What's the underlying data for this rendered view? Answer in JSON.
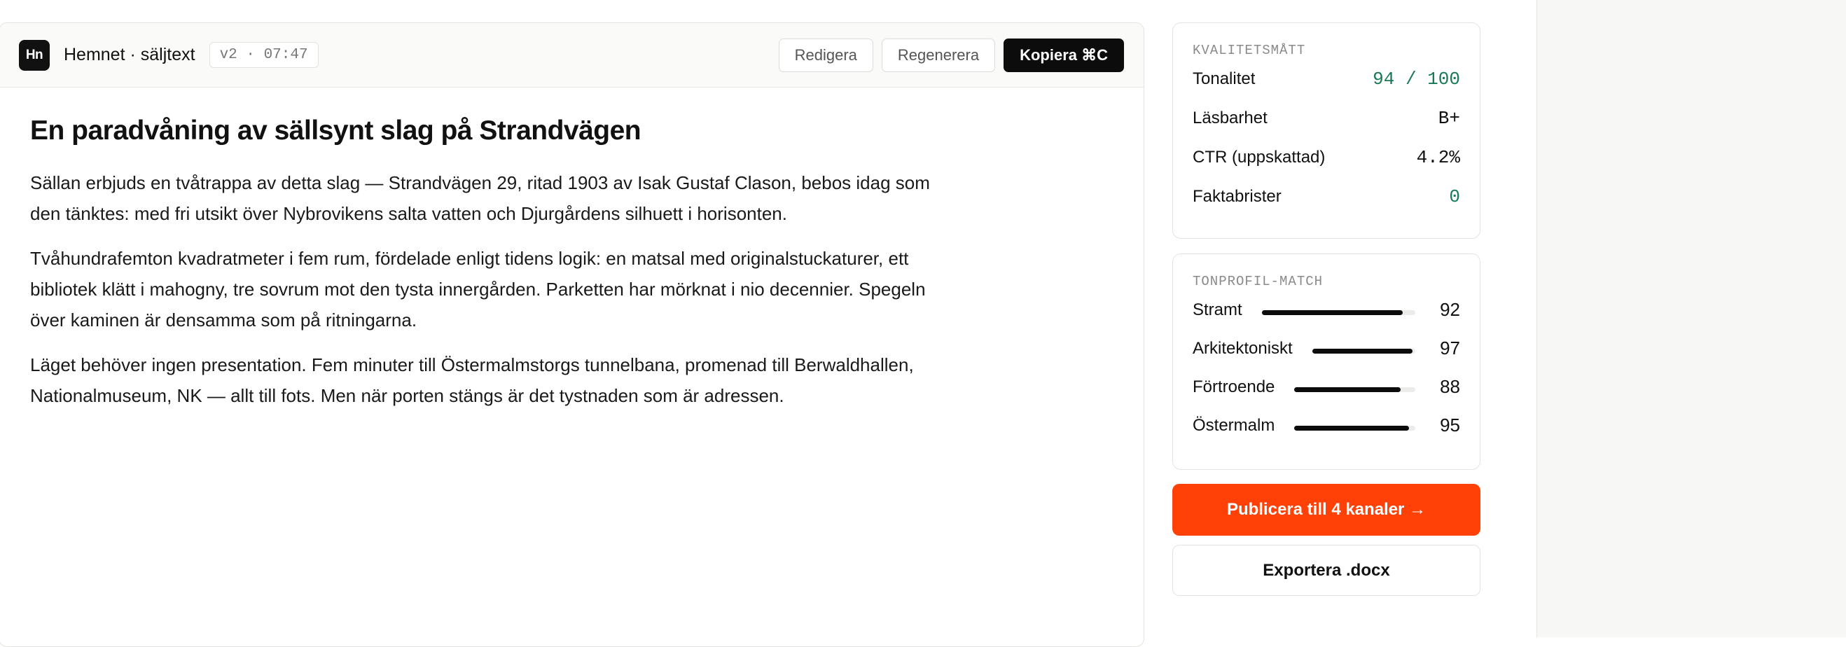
{
  "header": {
    "logo_text": "Hn",
    "title": "Hemnet · säljtext",
    "version": "v2 · 07:47",
    "actions": {
      "edit": "Redigera",
      "regenerate": "Regenerera",
      "copy": "Kopiera ⌘C"
    }
  },
  "document": {
    "headline": "En paradvåning av sällsynt slag på Strandvägen",
    "paragraphs": [
      "Sällan erbjuds en tvåtrappa av detta slag — Strandvägen 29, ritad 1903 av Isak Gustaf Clason, bebos idag som den tänktes: med fri utsikt över Nybrovikens salta vatten och Djurgårdens silhuett i horisonten.",
      "Tvåhundrafemton kvadratmeter i fem rum, fördelade enligt tidens logik: en matsal med originalstuckaturer, ett bibliotek klätt i mahogny, tre sovrum mot den tysta innergården. Parketten har mörknat i nio decennier. Spegeln över kaminen är densamma som på ritningarna.",
      "Läget behöver ingen presentation. Fem minuter till Östermalmstorgs tunnelbana, promenad till Berwaldhallen, Nationalmuseum, NK — allt till fots. Men när porten stängs är det tystnaden som är adressen."
    ]
  },
  "quality": {
    "label": "KVALITETSMÅTT",
    "metrics": [
      {
        "label": "Tonalitet",
        "value": "94 / 100",
        "highlight": true
      },
      {
        "label": "Läsbarhet",
        "value": "B+",
        "highlight": false
      },
      {
        "label": "CTR (uppskattad)",
        "value": "4.2%",
        "highlight": false
      },
      {
        "label": "Faktabrister",
        "value": "0",
        "highlight": true
      }
    ],
    "highlight_color": "#177a55"
  },
  "tone_profile": {
    "label": "TONPROFIL-MATCH",
    "items": [
      {
        "label": "Stramt",
        "value": "92",
        "fill": 0.92
      },
      {
        "label": "Arkitektoniskt",
        "value": "97",
        "fill": 0.97
      },
      {
        "label": "Förtroende",
        "value": "88",
        "fill": 0.88
      },
      {
        "label": "Östermalm",
        "value": "95",
        "fill": 0.95
      }
    ]
  },
  "actions": {
    "publish": "Publicera till 4 kanaler →",
    "export": "Exportera .docx",
    "publish_color": "#ff4007"
  }
}
